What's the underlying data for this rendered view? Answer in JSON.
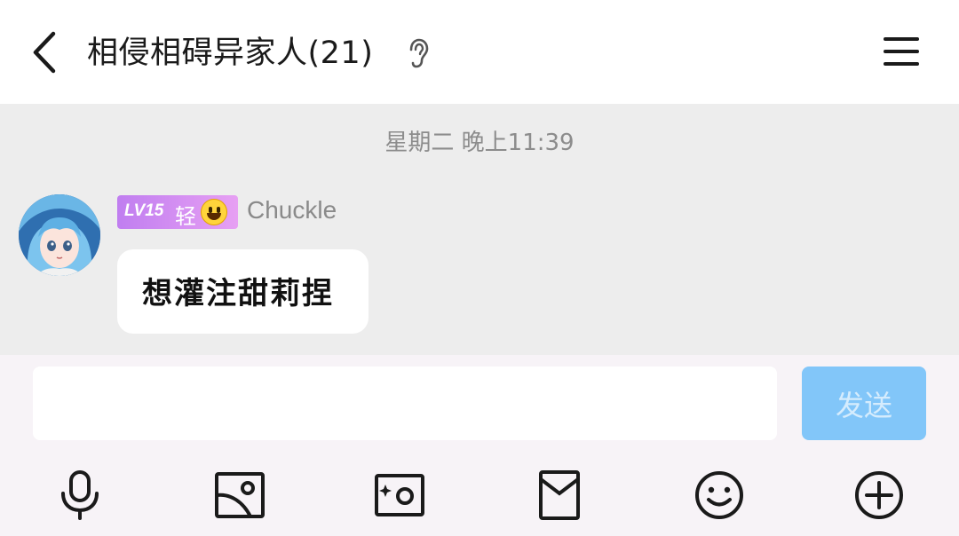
{
  "header": {
    "title": "相侵相碍异家人(21)",
    "back_icon": "chevron-left-icon",
    "mode_icon": "ear-icon",
    "menu_icon": "hamburger-menu-icon"
  },
  "chat": {
    "timestamp": "星期二 晚上11:39",
    "messages": [
      {
        "level": "LV15",
        "badge_text": "轻",
        "badge_emoji_icon": "grinning-face-icon",
        "username": "Chuckle",
        "text": "想灌注甜莉捏"
      }
    ]
  },
  "composer": {
    "input_value": "",
    "input_placeholder": "",
    "send_label": "发送"
  },
  "toolbar": {
    "items": [
      "microphone-icon",
      "image-icon",
      "camera-icon",
      "red-packet-icon",
      "emoji-icon",
      "plus-circle-icon"
    ]
  },
  "colors": {
    "accent": "#82c6f9",
    "badge_start": "#c07ef0",
    "badge_end": "#e7a0f3",
    "chat_bg": "#ededed",
    "panel_bg": "#f7f3f7"
  }
}
